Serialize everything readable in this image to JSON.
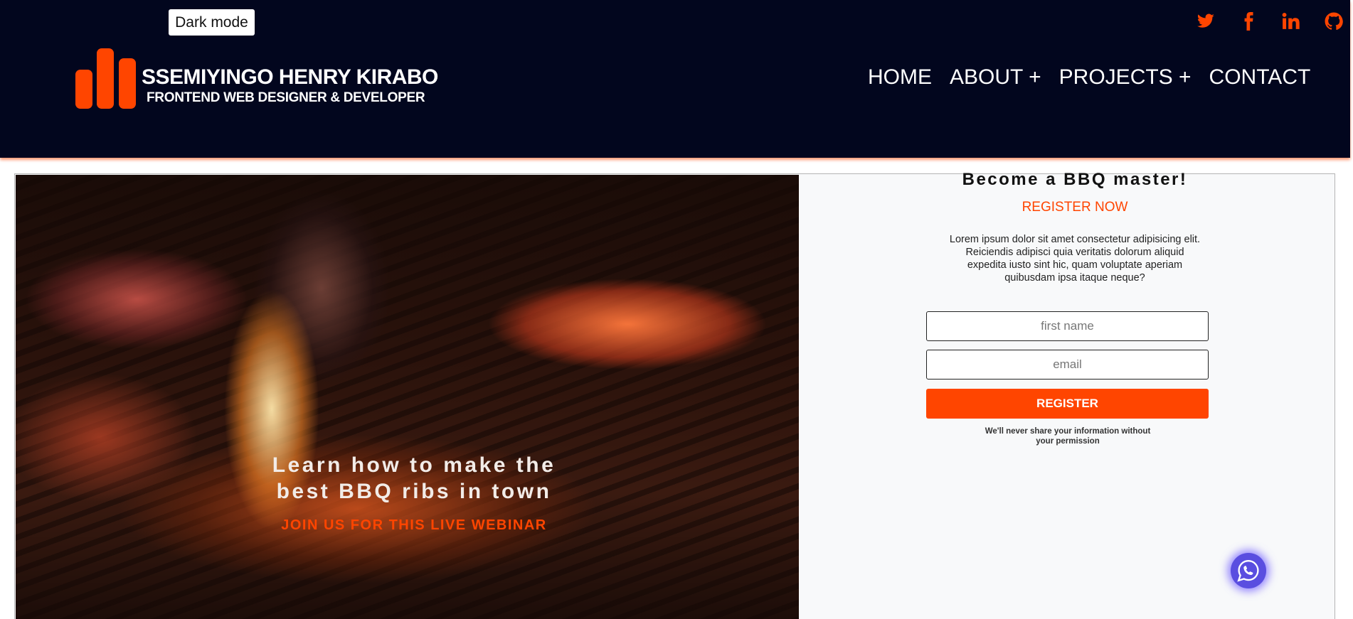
{
  "header": {
    "dark_mode_label": "Dark mode",
    "brand_name": "SSEMIYINGO HENRY KIRABO",
    "brand_subtitle": "FRONTEND WEB DESIGNER & DEVELOPER",
    "nav": [
      {
        "label": "HOME"
      },
      {
        "label": "ABOUT +"
      },
      {
        "label": "PROJECTS +"
      },
      {
        "label": "CONTACT"
      }
    ],
    "social_icons": [
      "twitter-icon",
      "facebook-icon",
      "linkedin-icon",
      "github-icon"
    ]
  },
  "hero": {
    "title": "Learn how to make the best BBQ ribs in town",
    "subtitle": "JOIN US FOR THIS LIVE WEBINAR"
  },
  "form": {
    "title": "Become a BBQ master!",
    "cta": "REGISTER NOW",
    "description": "Lorem ipsum dolor sit amet consectetur adipisicing elit. Reiciendis adipisci quia veritatis dolorum aliquid expedita iusto sint hic, quam voluptate aperiam quibusdam ipsa itaque neque?",
    "first_name_placeholder": "first name",
    "email_placeholder": "email",
    "register_label": "REGISTER",
    "privacy_note": "We'll never share your information without your permission"
  },
  "colors": {
    "header_bg": "#02061e",
    "accent": "#ff4500",
    "card_bg": "#f8f9fa"
  },
  "floating": {
    "whatsapp_icon": "whatsapp-icon"
  }
}
